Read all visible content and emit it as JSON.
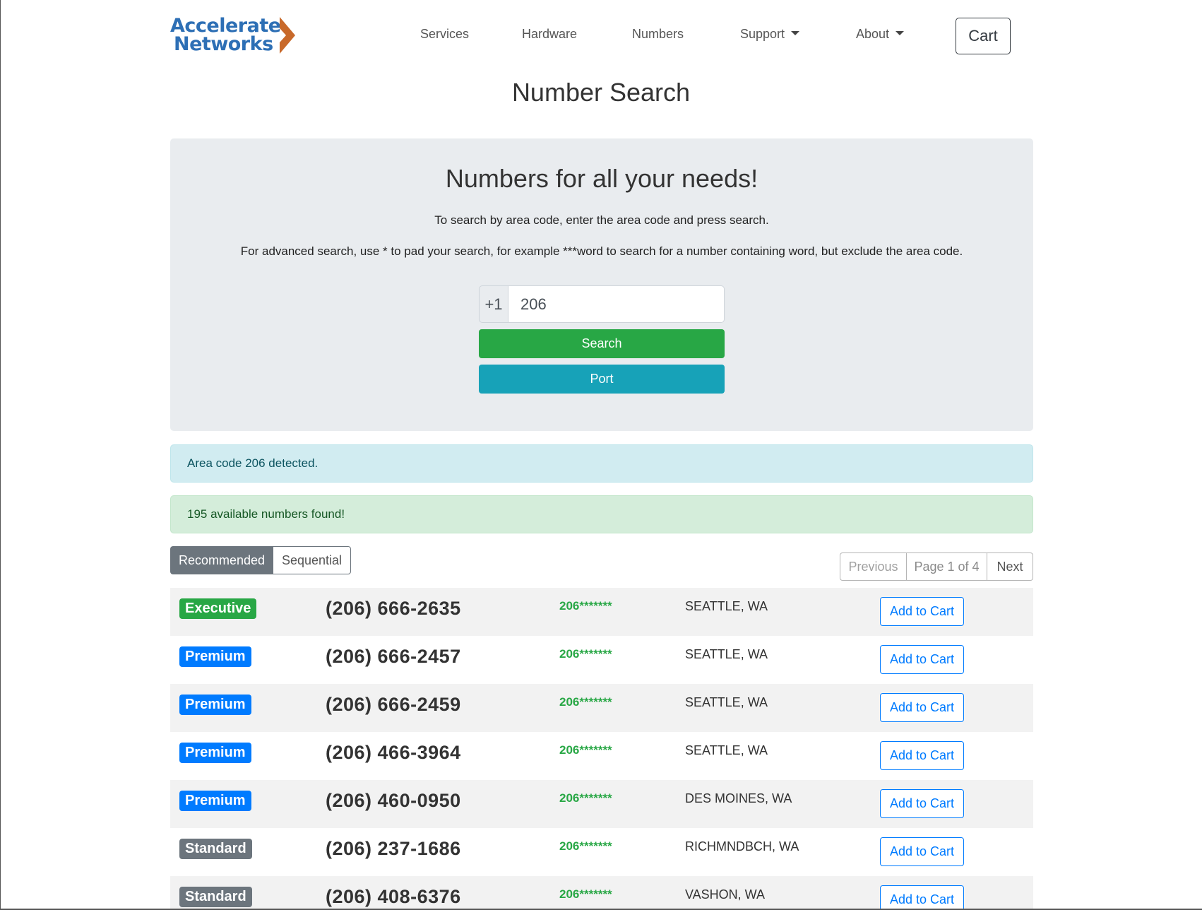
{
  "nav": {
    "logo_line1": "Accelerate",
    "logo_line2": "Networks",
    "links": [
      "Services",
      "Hardware",
      "Numbers",
      "Support",
      "About"
    ],
    "cart_label": "Cart"
  },
  "page_title": "Number Search",
  "jumbotron": {
    "title": "Numbers for all your needs!",
    "instruction1": "To search by area code, enter the area code and press search.",
    "instruction2": "For advanced search, use * to pad your search, for example ***word to search for a number containing word, but exclude the area code.",
    "country_prefix": "+1",
    "search_value": "206",
    "search_button": "Search",
    "port_button": "Port"
  },
  "alerts": {
    "info": "Area code 206 detected.",
    "success": "195 available numbers found!"
  },
  "view_toggle": {
    "recommended": "Recommended",
    "sequential": "Sequential"
  },
  "pagination": {
    "previous": "Previous",
    "page_indicator": "Page 1 of 4",
    "next": "Next"
  },
  "colors": {
    "Executive": "#28a745",
    "Premium": "#007bff",
    "Standard": "#6c757d"
  },
  "results": [
    {
      "tier": "Executive",
      "number": "(206) 666-2635",
      "pattern": "206*******",
      "location": "SEATTLE, WA",
      "action": "Add to Cart"
    },
    {
      "tier": "Premium",
      "number": "(206) 666-2457",
      "pattern": "206*******",
      "location": "SEATTLE, WA",
      "action": "Add to Cart"
    },
    {
      "tier": "Premium",
      "number": "(206) 666-2459",
      "pattern": "206*******",
      "location": "SEATTLE, WA",
      "action": "Add to Cart"
    },
    {
      "tier": "Premium",
      "number": "(206) 466-3964",
      "pattern": "206*******",
      "location": "SEATTLE, WA",
      "action": "Add to Cart"
    },
    {
      "tier": "Premium",
      "number": "(206) 460-0950",
      "pattern": "206*******",
      "location": "DES MOINES, WA",
      "action": "Add to Cart"
    },
    {
      "tier": "Standard",
      "number": "(206) 237-1686",
      "pattern": "206*******",
      "location": "RICHMNDBCH, WA",
      "action": "Add to Cart"
    },
    {
      "tier": "Standard",
      "number": "(206) 408-6376",
      "pattern": "206*******",
      "location": "VASHON, WA",
      "action": "Add to Cart"
    }
  ]
}
